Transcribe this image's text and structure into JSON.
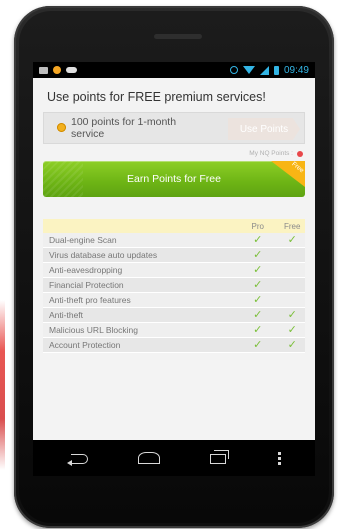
{
  "status_bar": {
    "time": "09:49"
  },
  "screen": {
    "title": "Use points for FREE premium services!",
    "points_offer": "100 points for 1-month service",
    "use_points_label": "Use Points",
    "nq_points_label": "My NQ Points :",
    "earn_button_label": "Earn Points for Free",
    "free_ribbon_label": "Free"
  },
  "features": {
    "col_pro": "Pro",
    "col_free": "Free",
    "check_glyph": "✓",
    "rows": [
      {
        "name": "Dual-engine Scan",
        "pro": true,
        "free": true
      },
      {
        "name": "Virus database auto updates",
        "pro": true,
        "free": false
      },
      {
        "name": "Anti-eavesdropping",
        "pro": true,
        "free": false
      },
      {
        "name": "Financial Protection",
        "pro": true,
        "free": false
      },
      {
        "name": "Anti-theft pro features",
        "pro": true,
        "free": false
      },
      {
        "name": "Anti-theft",
        "pro": true,
        "free": true
      },
      {
        "name": "Malicious URL Blocking",
        "pro": true,
        "free": true
      },
      {
        "name": "Account Protection",
        "pro": true,
        "free": true
      }
    ]
  },
  "colors": {
    "accent_green": "#6db415",
    "status_blue": "#33b5e5",
    "ribbon_orange": "#f8b514",
    "header_yellow": "#fbf3c2"
  },
  "navigation": {
    "icons": [
      "back-icon",
      "home-icon",
      "recent-apps-icon",
      "menu-icon"
    ]
  }
}
